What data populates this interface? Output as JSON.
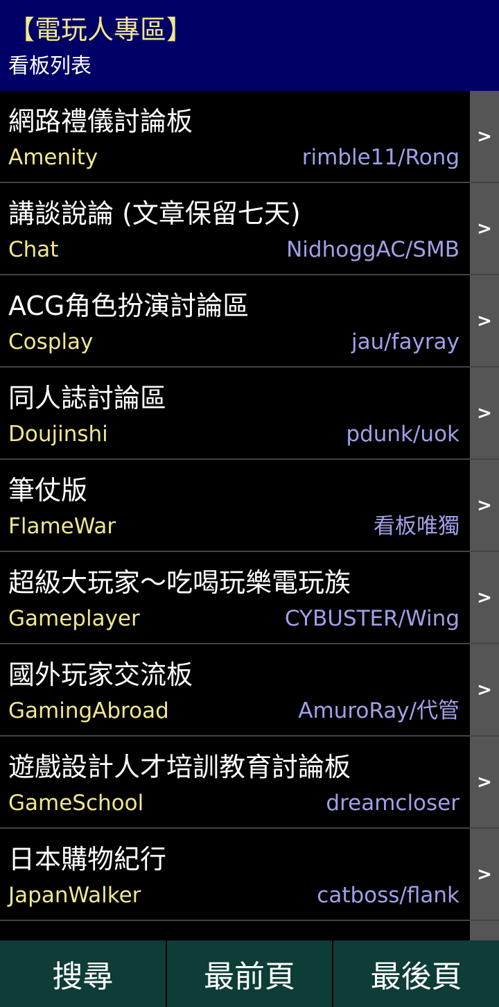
{
  "header": {
    "title": "【電玩人專區】",
    "subtitle": "看板列表"
  },
  "boards": [
    {
      "title": "網路禮儀討論板",
      "name": "Amenity",
      "moderators": "rimble11/Rong",
      "arrow": ">"
    },
    {
      "title": "講談說論 (文章保留七天)",
      "name": "Chat",
      "moderators": "NidhoggAC/SMB",
      "arrow": ">"
    },
    {
      "title": "ACG角色扮演討論區",
      "name": "Cosplay",
      "moderators": "jau/fayray",
      "arrow": ">"
    },
    {
      "title": "同人誌討論區",
      "name": "Doujinshi",
      "moderators": "pdunk/uok",
      "arrow": ">"
    },
    {
      "title": "筆仗版",
      "name": "FlameWar",
      "moderators": "看板唯獨",
      "arrow": ">"
    },
    {
      "title": "超級大玩家～吃喝玩樂電玩族",
      "name": "Gameplayer",
      "moderators": "CYBUSTER/Wing",
      "arrow": ">"
    },
    {
      "title": "國外玩家交流板",
      "name": "GamingAbroad",
      "moderators": "AmuroRay/代管",
      "arrow": ">"
    },
    {
      "title": "遊戲設計人才培訓教育討論板",
      "name": "GameSchool",
      "moderators": "dreamcloser",
      "arrow": ">"
    },
    {
      "title": "日本購物紀行",
      "name": "JapanWalker",
      "moderators": "catboss/flank",
      "arrow": ">"
    }
  ],
  "footer": {
    "search_label": "搜尋",
    "first_page_label": "最前頁",
    "last_page_label": "最後頁"
  },
  "colors": {
    "header_bg": "#000066",
    "board_name": "#f0e88c",
    "moderator": "#a0a0e8",
    "footer_bg": "#0e3c36"
  }
}
